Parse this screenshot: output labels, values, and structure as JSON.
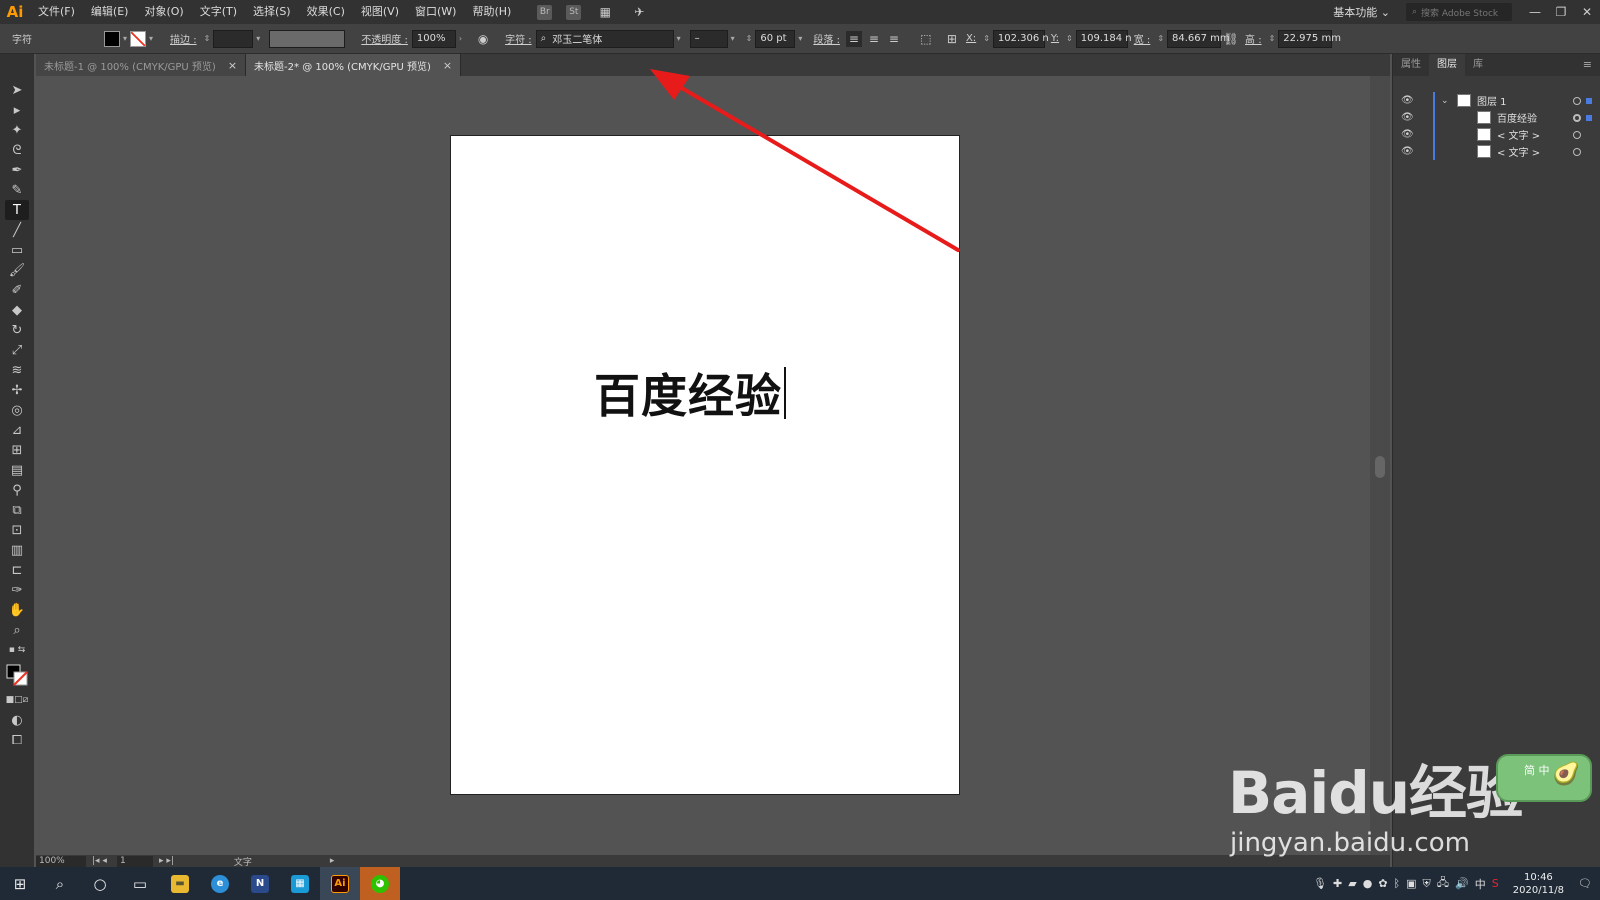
{
  "app": {
    "logo": "Ai"
  },
  "menu": [
    "文件(F)",
    "编辑(E)",
    "对象(O)",
    "文字(T)",
    "选择(S)",
    "效果(C)",
    "视图(V)",
    "窗口(W)",
    "帮助(H)"
  ],
  "menu_icons": [
    "Br",
    "St"
  ],
  "workspace": {
    "label": "基本功能",
    "search_placeholder": "搜索 Adobe Stock"
  },
  "control": {
    "mode": "字符",
    "stroke_label": "描边 :",
    "opacity_label": "不透明度 :",
    "opacity_value": "100%",
    "char_label": "字符 :",
    "font_name": "邓玉二笔体",
    "font_style": "–",
    "font_size": "60 pt",
    "para_label": "段落 :",
    "x_label": "X:",
    "x_value": "102.306 n",
    "y_label": "Y:",
    "y_value": "109.184 n",
    "w_label": "宽 :",
    "w_value": "84.667 mm",
    "h_label": "高 :",
    "h_value": "22.975 mm"
  },
  "tabs": [
    {
      "label": "未标题-1 @ 100% (CMYK/GPU 预览)",
      "active": false
    },
    {
      "label": "未标题-2* @ 100% (CMYK/GPU 预览)",
      "active": true
    }
  ],
  "artboard": {
    "text": "百度经验"
  },
  "panel": {
    "tabs": [
      "属性",
      "图层",
      "库"
    ],
    "active_tab": "图层",
    "layers": [
      {
        "name": "图层 1",
        "level": 0
      },
      {
        "name": "百度经验",
        "level": 1
      },
      {
        "name": "< 文字 >",
        "level": 1
      },
      {
        "name": "< 文字 >",
        "level": 1
      }
    ]
  },
  "status": {
    "zoom": "100%",
    "page": "1",
    "tool": "文字"
  },
  "taskbar": {
    "time": "10:46",
    "date": "2020/11/8",
    "ime": "中"
  },
  "watermark": {
    "logo": "Baidu经验",
    "url": "jingyan.baidu.com",
    "ime_badge": "简 中"
  },
  "colors": {
    "accent": "#4a7be0",
    "arrow": "#e81b1b",
    "ai_orange": "#ff9a00"
  }
}
